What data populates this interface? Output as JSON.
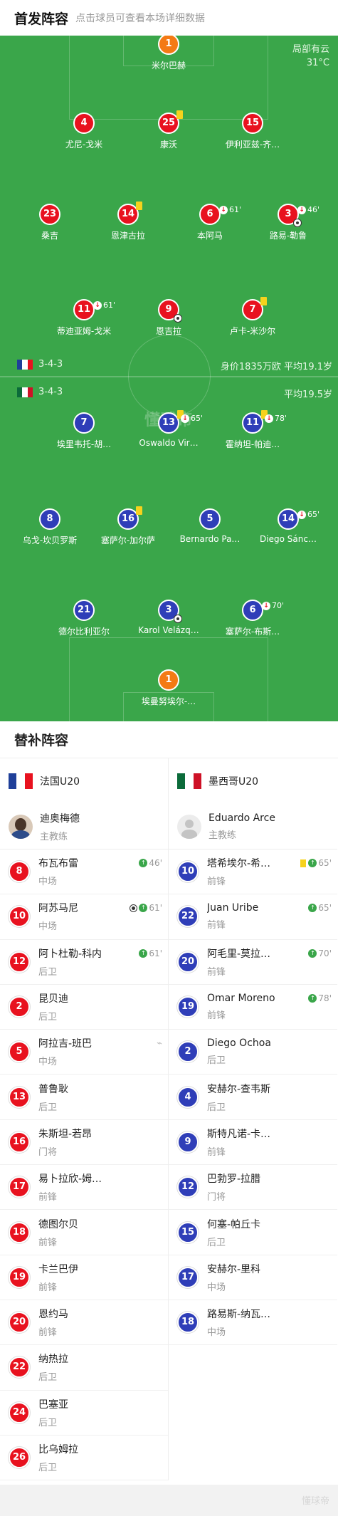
{
  "header": {
    "title": "首发阵容",
    "subtitle": "点击球员可查看本场详细数据"
  },
  "weather": {
    "condition": "局部有云",
    "temp": "31°C"
  },
  "watermark": "懂球帝",
  "teams": {
    "home": {
      "name": "法国U20",
      "formation": "3-4-3",
      "stats": "身价1835万欧 平均19.1岁",
      "flag_colors": [
        "#1f3f99",
        "#ffffff",
        "#e8121f"
      ]
    },
    "away": {
      "name": "墨西哥U20",
      "formation": "3-4-3",
      "stats": "平均19.5岁",
      "flag_colors": [
        "#0b6b3a",
        "#ffffff",
        "#ce1126"
      ]
    }
  },
  "home_players": [
    {
      "num": "1",
      "name": "米尔巴赫"
    },
    {
      "num": "4",
      "name": "尤尼-戈米"
    },
    {
      "num": "25",
      "name": "康沃"
    },
    {
      "num": "15",
      "name": "伊利亚兹-齐…"
    },
    {
      "num": "23",
      "name": "桑吉"
    },
    {
      "num": "14",
      "name": "恩津古拉"
    },
    {
      "num": "6",
      "name": "本阿马",
      "sub": "61'"
    },
    {
      "num": "3",
      "name": "路易-勒鲁",
      "sub": "46'"
    },
    {
      "num": "11",
      "name": "蒂迪亚姆-戈米",
      "sub": "61'"
    },
    {
      "num": "9",
      "name": "恩吉拉"
    },
    {
      "num": "7",
      "name": "卢卡-米沙尔"
    }
  ],
  "away_players": [
    {
      "num": "7",
      "name": "埃里韦托-胡…"
    },
    {
      "num": "13",
      "name": "Oswaldo Vir…",
      "sub": "65'"
    },
    {
      "num": "11",
      "name": "霍纳坦-帕迪…",
      "sub": "78'"
    },
    {
      "num": "8",
      "name": "乌戈-坎贝罗斯"
    },
    {
      "num": "16",
      "name": "塞萨尔-加尔萨"
    },
    {
      "num": "5",
      "name": "Bernardo Pa…"
    },
    {
      "num": "14",
      "name": "Diego Sánc…",
      "sub": "65'"
    },
    {
      "num": "21",
      "name": "德尔比利亚尔"
    },
    {
      "num": "3",
      "name": "Karol Velázq…"
    },
    {
      "num": "6",
      "name": "塞萨尔-布斯…",
      "sub": "70'"
    },
    {
      "num": "1",
      "name": "埃曼努埃尔-…"
    }
  ],
  "subs": {
    "title": "替补阵容",
    "coach_label": "主教练",
    "home_coach": "迪奥梅德",
    "away_coach": "Eduardo Arce",
    "home": [
      {
        "num": "8",
        "name": "布瓦布雷",
        "pos": "中场",
        "ev": "46'"
      },
      {
        "num": "10",
        "name": "阿苏马尼",
        "pos": "中场",
        "ev": "61'"
      },
      {
        "num": "12",
        "name": "阿卜杜勒-科内",
        "pos": "后卫",
        "ev": "61'"
      },
      {
        "num": "2",
        "name": "昆贝迪",
        "pos": "后卫"
      },
      {
        "num": "5",
        "name": "阿拉吉-班巴",
        "pos": "中场"
      },
      {
        "num": "13",
        "name": "普鲁耿",
        "pos": "后卫"
      },
      {
        "num": "16",
        "name": "朱斯坦-若昂",
        "pos": "门将"
      },
      {
        "num": "17",
        "name": "易卜拉欣-姆…",
        "pos": "前锋"
      },
      {
        "num": "18",
        "name": "德图尔贝",
        "pos": "前锋"
      },
      {
        "num": "19",
        "name": "卡兰巴伊",
        "pos": "前锋"
      },
      {
        "num": "20",
        "name": "恩约马",
        "pos": "前锋"
      },
      {
        "num": "22",
        "name": "纳热拉",
        "pos": "后卫"
      },
      {
        "num": "24",
        "name": "巴塞亚",
        "pos": "后卫"
      },
      {
        "num": "26",
        "name": "比乌姆拉",
        "pos": "后卫"
      }
    ],
    "away": [
      {
        "num": "10",
        "name": "塔希埃尔-希…",
        "pos": "前锋",
        "ev": "65'"
      },
      {
        "num": "22",
        "name": "Juan Uribe",
        "pos": "前锋",
        "ev": "65'"
      },
      {
        "num": "20",
        "name": "阿毛里-莫拉…",
        "pos": "前锋",
        "ev": "70'"
      },
      {
        "num": "19",
        "name": "Omar Moreno",
        "pos": "前锋",
        "ev": "78'"
      },
      {
        "num": "2",
        "name": "Diego Ochoa",
        "pos": "后卫"
      },
      {
        "num": "4",
        "name": "安赫尔-查韦斯",
        "pos": "后卫"
      },
      {
        "num": "9",
        "name": "斯特凡诺-卡…",
        "pos": "前锋"
      },
      {
        "num": "12",
        "name": "巴勃罗-拉腊",
        "pos": "门将"
      },
      {
        "num": "15",
        "name": "何塞-帕丘卡",
        "pos": "后卫"
      },
      {
        "num": "17",
        "name": "安赫尔-里科",
        "pos": "中场"
      },
      {
        "num": "18",
        "name": "路易斯-纳瓦…",
        "pos": "中场"
      }
    ]
  }
}
